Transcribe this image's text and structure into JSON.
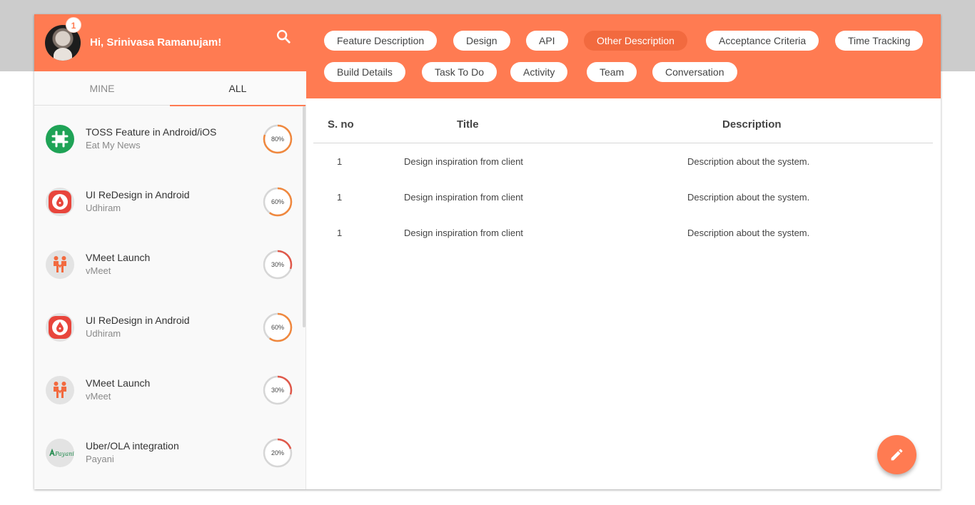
{
  "user": {
    "greeting": "Hi, Srinivasa Ramanujam!",
    "notification_count": "1"
  },
  "tabs": [
    {
      "label": "MINE"
    },
    {
      "label": "ALL"
    }
  ],
  "active_tab": "ALL",
  "projects": [
    {
      "name": "TOSS Feature in Android/iOS",
      "company": "Eat My News",
      "progress": 80,
      "progress_label": "80%",
      "logo": "hash-grid-logo"
    },
    {
      "name": "UI ReDesign in Android",
      "company": "Udhiram",
      "progress": 60,
      "progress_label": "60%",
      "logo": "blood-drop-logo"
    },
    {
      "name": "VMeet Launch",
      "company": "vMeet",
      "progress": 30,
      "progress_label": "30%",
      "logo": "people-logo"
    },
    {
      "name": "UI ReDesign in Android",
      "company": "Udhiram",
      "progress": 60,
      "progress_label": "60%",
      "logo": "blood-drop-logo"
    },
    {
      "name": "VMeet Launch",
      "company": "vMeet",
      "progress": 30,
      "progress_label": "30%",
      "logo": "people-logo"
    },
    {
      "name": "Uber/OLA integration",
      "company": "Payani",
      "progress": 20,
      "progress_label": "20%",
      "logo": "payani-logo"
    }
  ],
  "chips": [
    {
      "label": "Feature Description"
    },
    {
      "label": "Design"
    },
    {
      "label": "API"
    },
    {
      "label": "Other Description"
    },
    {
      "label": "Acceptance Criteria"
    },
    {
      "label": "Time Tracking"
    },
    {
      "label": "Build Details"
    },
    {
      "label": "Task To Do"
    },
    {
      "label": "Activity"
    },
    {
      "label": "Team"
    },
    {
      "label": "Conversation"
    }
  ],
  "active_chip": "Other Description",
  "table": {
    "headers": {
      "sno": "S. no",
      "title": "Title",
      "description": "Description"
    },
    "rows": [
      {
        "sno": "1",
        "title": "Design inspiration from client",
        "description": "Description about the system."
      },
      {
        "sno": "1",
        "title": "Design inspiration from client",
        "description": "Description about the system."
      },
      {
        "sno": "1",
        "title": "Design inspiration from client",
        "description": "Description about the system."
      }
    ]
  },
  "colors": {
    "accent": "#ff7b52",
    "accent_dark": "#f26a3f",
    "ring_high": "#f0883e",
    "ring_low": "#e0584a",
    "ring_track": "#d6d6d6"
  }
}
